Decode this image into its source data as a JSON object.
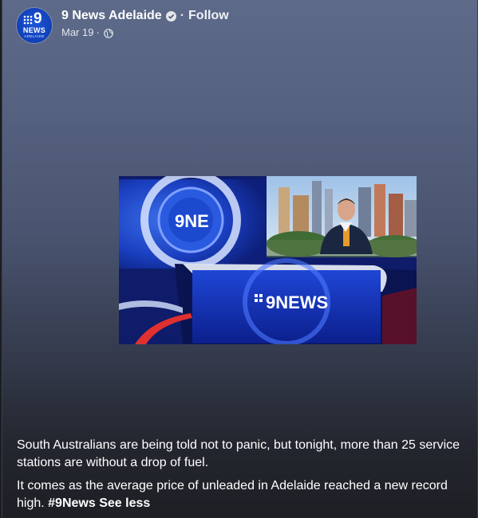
{
  "post": {
    "page_name": "9 News Adelaide",
    "separator": "·",
    "follow_label": "Follow",
    "date": "Mar 19",
    "date_separator": "·",
    "audience_icon": "globe-icon",
    "verified_icon": "verified-badge-icon"
  },
  "avatar": {
    "nine": "9",
    "news": "NEWS",
    "subtitle": "ADELAIDE"
  },
  "video": {
    "desk_logo": "9NEWS",
    "screen_logo": "9NE"
  },
  "caption": {
    "paragraph1": "South Australians are being told not to panic, but tonight, more than 25 service stations are without a drop of fuel.",
    "paragraph2": "It comes as the average price of unleaded in Adelaide reached a new record high.",
    "hashtag": "#9News",
    "see_less": "See less"
  },
  "colors": {
    "brand_blue": "#1140b8",
    "background_top": "#5d6a89",
    "background_bottom": "#1d1f24"
  }
}
